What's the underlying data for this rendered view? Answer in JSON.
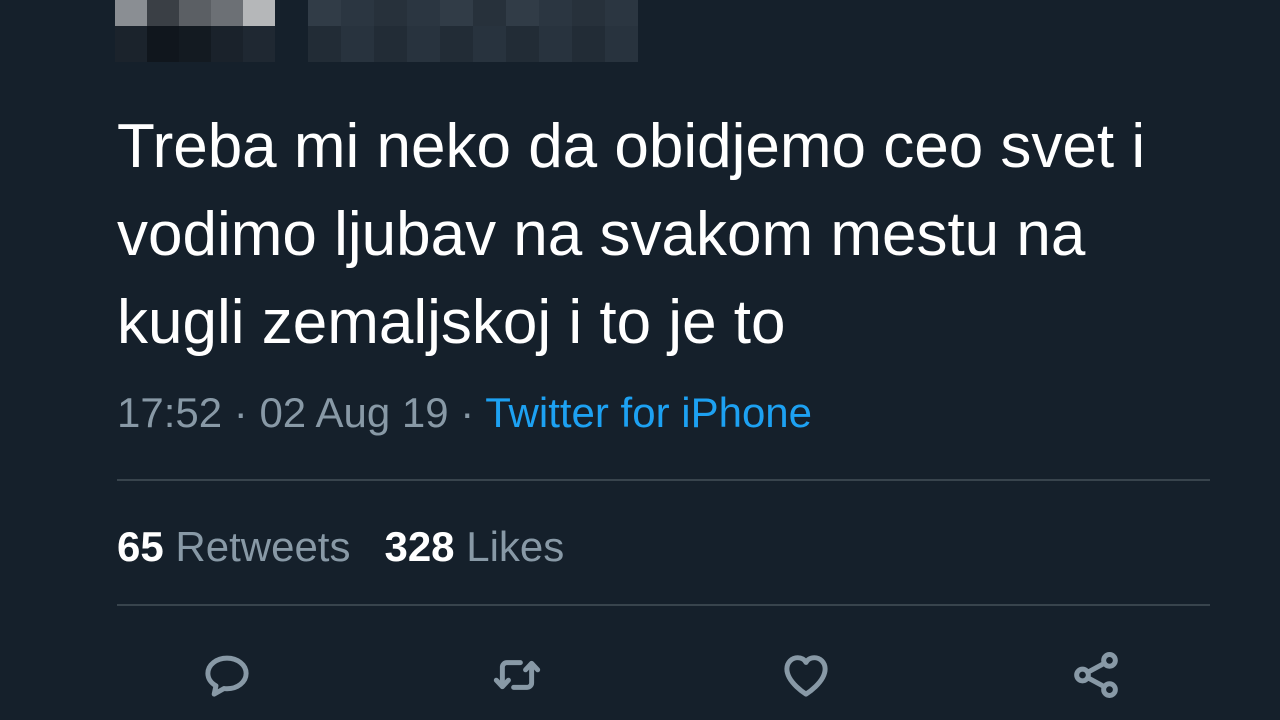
{
  "tweet": {
    "text": "Treba mi neko da obidjemo ceo svet i vodimo ljubav na svakom mestu na kugli zemaljskoj i to je to",
    "time": "17:52",
    "separator": " · ",
    "date": "02 Aug 19",
    "source": "Twitter for iPhone"
  },
  "stats": {
    "retweets_count": "65",
    "retweets_label": "Retweets",
    "likes_count": "328",
    "likes_label": "Likes"
  },
  "actions": [
    {
      "name": "reply",
      "icon": "reply-icon"
    },
    {
      "name": "retweet",
      "icon": "retweet-icon"
    },
    {
      "name": "like",
      "icon": "heart-icon"
    },
    {
      "name": "share",
      "icon": "share-icon"
    }
  ],
  "colors": {
    "background": "#15202b",
    "text": "#ffffff",
    "secondary_text": "#8899a6",
    "link": "#1da1f2",
    "divider": "#38444d"
  }
}
